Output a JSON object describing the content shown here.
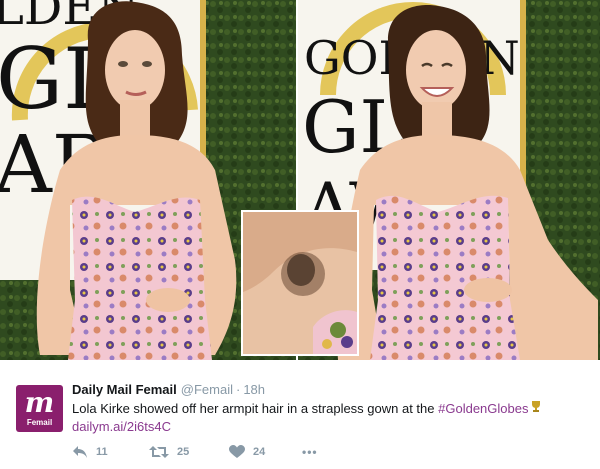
{
  "photo": {
    "backdrop_left_text": "GOLDEN GLOBE AWARDS",
    "backdrop_right_text": "GOLDEN GLOBE AWARDS"
  },
  "tweet": {
    "author_name": "Daily Mail Femail",
    "handle": "@Femail",
    "separator": "·",
    "timestamp": "18h",
    "avatar_mark": "m",
    "avatar_label": "Femail",
    "text": "Lola Kirke showed off her armpit hair in a strapless gown at the",
    "hashtag": "#GoldenGlobes",
    "link": "dailym.ai/2i6ts4C",
    "counts": {
      "replies": "11",
      "retweets": "25",
      "likes": "24"
    },
    "more_label": "•••"
  },
  "colors": {
    "brand": "#8a1f6d",
    "hashtag": "#8a3a8f",
    "muted": "#8899a6",
    "gown": "#f2c6cf"
  },
  "icons": [
    "reply-icon",
    "retweet-icon",
    "heart-icon",
    "more-icon",
    "trophy-icon"
  ]
}
